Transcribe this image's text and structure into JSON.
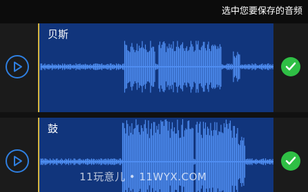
{
  "header": {
    "title": "选中您要保存的音频"
  },
  "tracks": [
    {
      "name": "贝斯",
      "selected": true
    },
    {
      "name": "鼓",
      "selected": true
    }
  ],
  "watermark": "11玩意儿 • 11WYX.COM",
  "colors": {
    "wave": "#4f8ef2",
    "wave_bg": "#11357c",
    "accent": "#2f7fe0",
    "check": "#2fbf45",
    "start_line": "#d8b740"
  },
  "icons": [
    "play-icon",
    "check-icon"
  ]
}
